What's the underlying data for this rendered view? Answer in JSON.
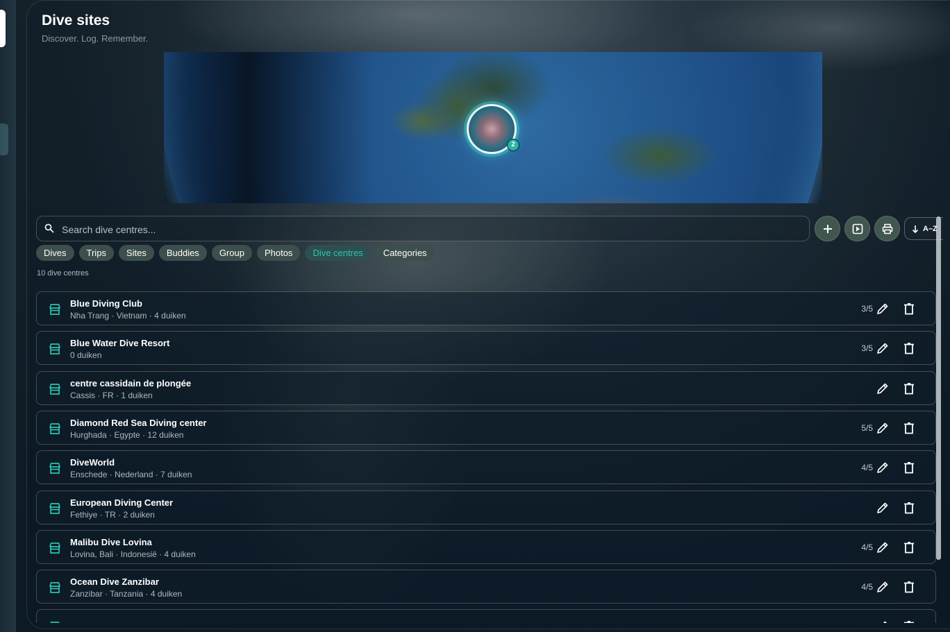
{
  "header": {
    "title": "Dive sites",
    "subtitle": "Discover. Log. Remember."
  },
  "map": {
    "marker_count": "2"
  },
  "search": {
    "placeholder": "Search dive centres..."
  },
  "toolbar": {
    "add_icon": "plus-icon",
    "slideshow_icon": "play-square-icon",
    "print_icon": "printer-icon",
    "sort_label": "A–Z"
  },
  "tabs": [
    {
      "label": "Dives",
      "active": false
    },
    {
      "label": "Trips",
      "active": false
    },
    {
      "label": "Sites",
      "active": false
    },
    {
      "label": "Buddies",
      "active": false
    },
    {
      "label": "Group",
      "active": false
    },
    {
      "label": "Photos",
      "active": false
    },
    {
      "label": "Dive centres",
      "active": true
    },
    {
      "label": "Categories",
      "active": false
    }
  ],
  "summary": "10 dive centres",
  "colors": {
    "accent": "#2fc3b0",
    "chip": "#3d4f4c"
  },
  "centres": [
    {
      "name": "Blue Diving Club",
      "details": "Nha Trang · Vietnam · 4 duiken",
      "rating": "3/5"
    },
    {
      "name": "Blue Water Dive Resort",
      "details": "0 duiken",
      "rating": "3/5"
    },
    {
      "name": "centre cassidain de plongée",
      "details": "Cassis · FR · 1 duiken",
      "rating": ""
    },
    {
      "name": "Diamond Red Sea Diving center",
      "details": "Hurghada · Egypte · 12 duiken",
      "rating": "5/5"
    },
    {
      "name": "DiveWorld",
      "details": "Enschede · Nederland · 7 duiken",
      "rating": "4/5"
    },
    {
      "name": "European Diving Center",
      "details": "Fethiye · TR · 2 duiken",
      "rating": ""
    },
    {
      "name": "Malibu Dive Lovina",
      "details": "Lovina, Bali · Indonesië · 4 duiken",
      "rating": "4/5"
    },
    {
      "name": "Ocean Dive Zanzibar",
      "details": "Zanzibar · Tanzania · 4 duiken",
      "rating": "4/5"
    },
    {
      "name": "",
      "details": "",
      "rating": ""
    }
  ]
}
